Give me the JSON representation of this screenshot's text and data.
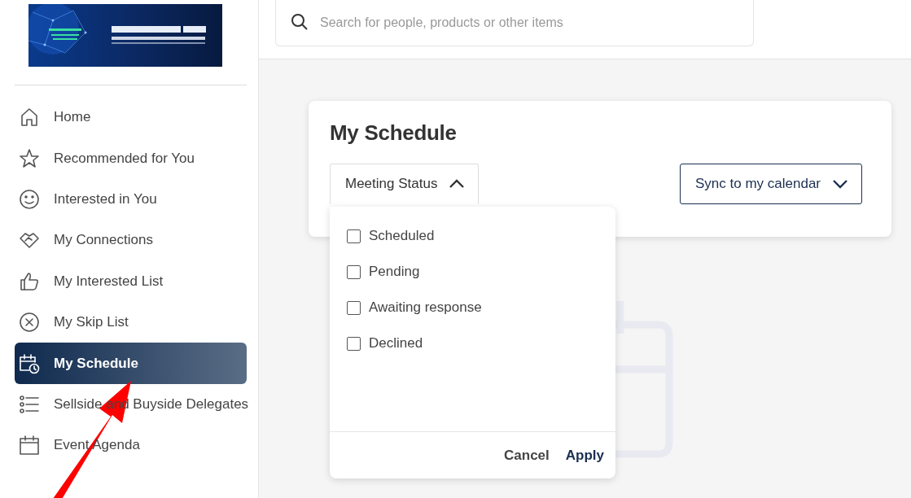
{
  "sidebar": {
    "nav": [
      {
        "label": "Home",
        "selected": false
      },
      {
        "label": "Recommended for You",
        "selected": false
      },
      {
        "label": "Interested in You",
        "selected": false
      },
      {
        "label": "My Connections",
        "selected": false
      },
      {
        "label": "My Interested List",
        "selected": false
      },
      {
        "label": "My Skip List",
        "selected": false
      },
      {
        "label": "My Schedule",
        "selected": true
      },
      {
        "label": "Sellside and Buyside Delegates",
        "selected": false
      },
      {
        "label": "Event Agenda",
        "selected": false
      }
    ]
  },
  "search": {
    "placeholder": "Search for people, products or other items"
  },
  "schedule": {
    "title": "My Schedule",
    "filter": {
      "label": "Meeting Status",
      "expanded": true
    },
    "sync_button": "Sync to my calendar",
    "status_options": [
      {
        "label": "Scheduled",
        "checked": false
      },
      {
        "label": "Pending",
        "checked": false
      },
      {
        "label": "Awaiting response",
        "checked": false
      },
      {
        "label": "Declined",
        "checked": false
      }
    ],
    "cancel": "Cancel",
    "apply": "Apply"
  }
}
